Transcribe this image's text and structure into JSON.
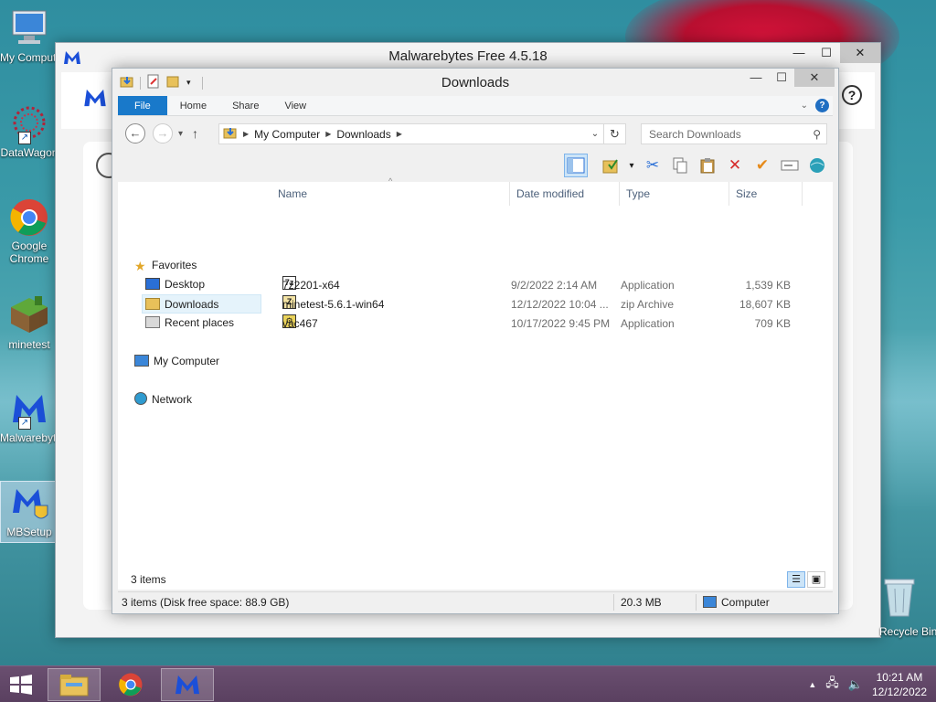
{
  "desktop": {
    "icons": [
      {
        "label": "My Computer"
      },
      {
        "label": "DataWagon"
      },
      {
        "label": "Google Chrome"
      },
      {
        "label": "minetest"
      },
      {
        "label": "Malwarebytes"
      },
      {
        "label": "MBSetup"
      }
    ],
    "recycle_bin_label": "Recycle Bin"
  },
  "malwarebytes": {
    "title": "Malwarebytes Free  4.5.18"
  },
  "explorer": {
    "title": "Downloads",
    "ribbon_tabs": [
      "File",
      "Home",
      "Share",
      "View"
    ],
    "address": {
      "segments": [
        "My Computer",
        "Downloads"
      ]
    },
    "search_placeholder": "Search Downloads",
    "nav": {
      "favorites": "Favorites",
      "desktop": "Desktop",
      "downloads": "Downloads",
      "recent": "Recent places",
      "computer": "My Computer",
      "network": "Network"
    },
    "columns": [
      "Name",
      "Date modified",
      "Type",
      "Size"
    ],
    "files": [
      {
        "name": "7z2201-x64",
        "date": "9/2/2022 2:14 AM",
        "type": "Application",
        "size": "1,539 KB"
      },
      {
        "name": "minetest-5.6.1-win64",
        "date": "12/12/2022 10:04 ...",
        "type": "zip Archive",
        "size": "18,607 KB"
      },
      {
        "name": "vac467",
        "date": "10/17/2022 9:45 PM",
        "type": "Application",
        "size": "709 KB"
      }
    ],
    "item_count": "3 items",
    "status": {
      "left": "3 items (Disk free space: 88.9 GB)",
      "size": "20.3 MB",
      "location": "Computer"
    }
  },
  "taskbar": {
    "time": "10:21 AM",
    "date": "12/12/2022"
  }
}
